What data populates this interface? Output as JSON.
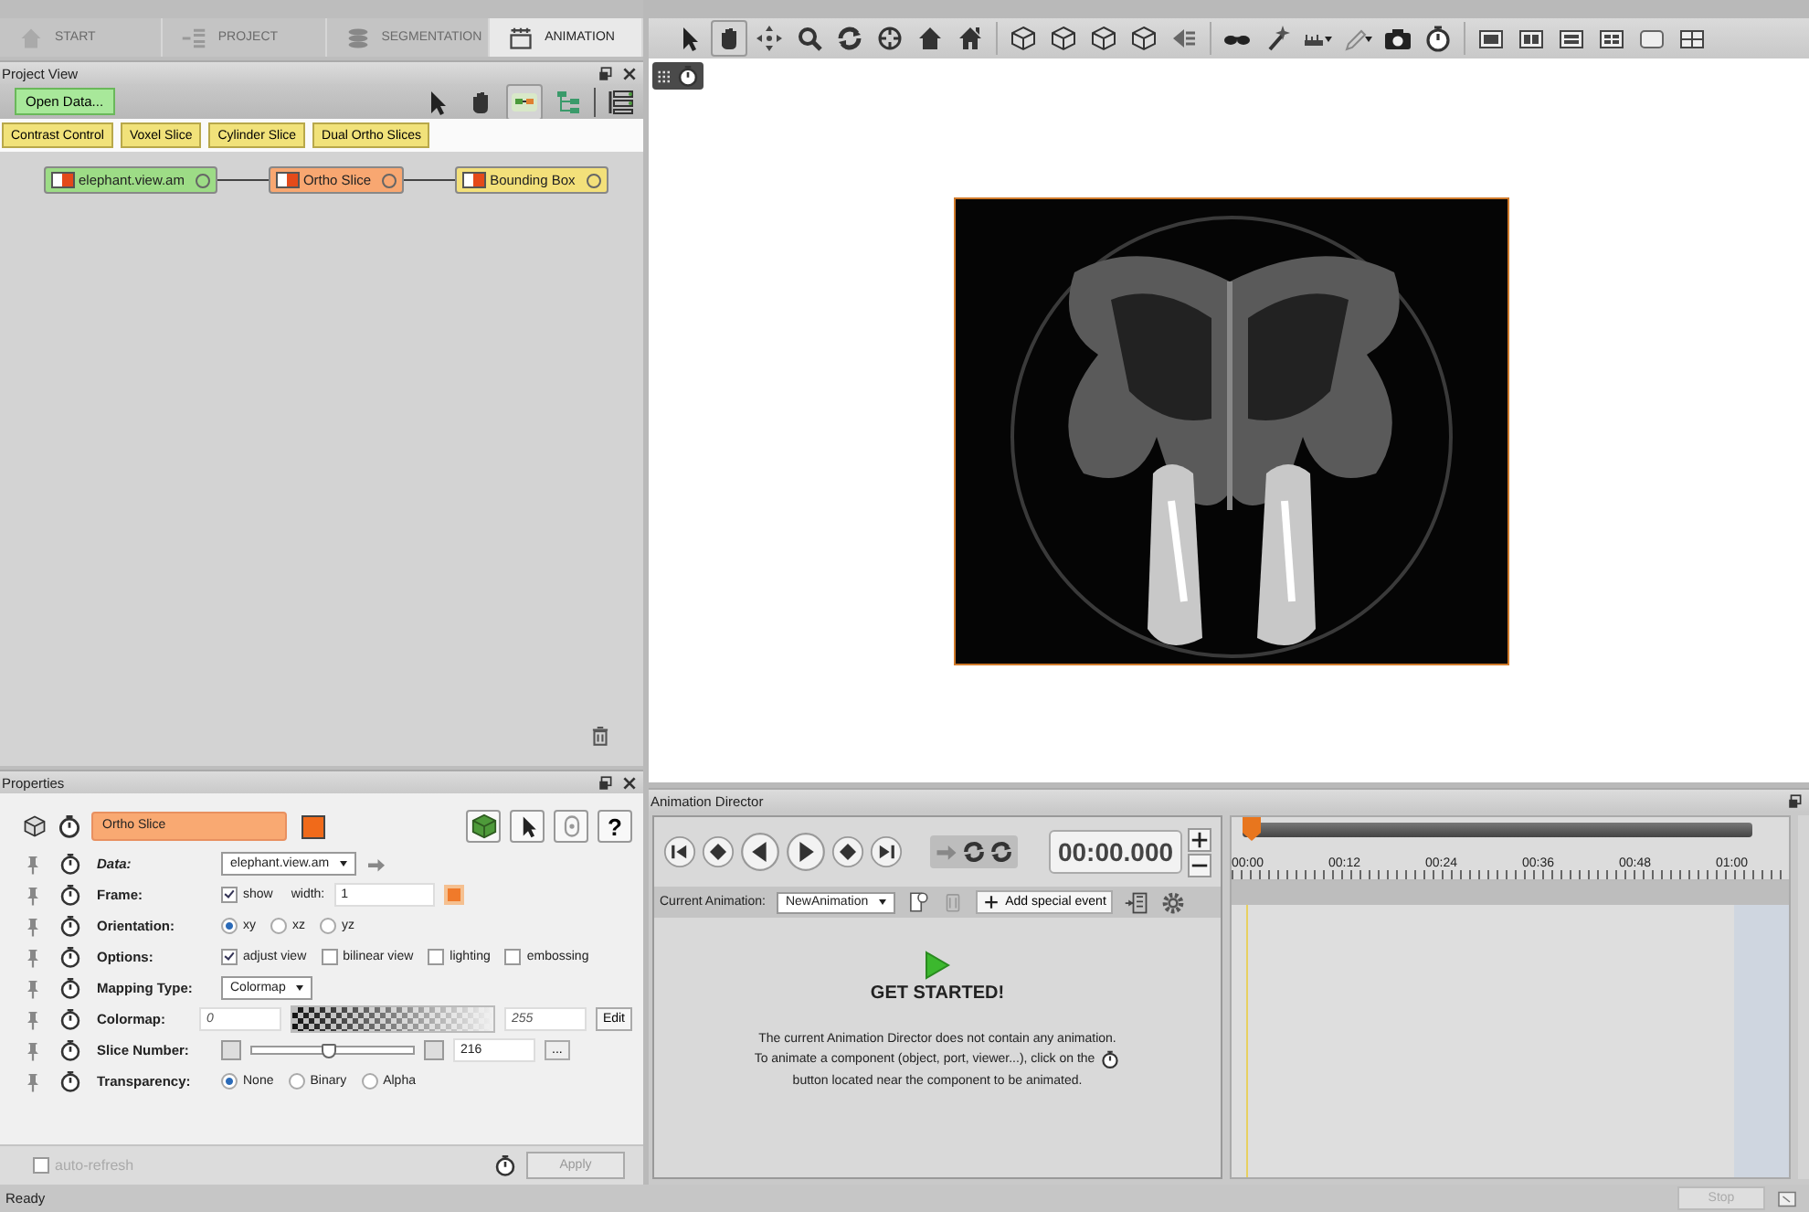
{
  "tabs": [
    {
      "label": "START",
      "selected": false
    },
    {
      "label": "PROJECT",
      "selected": false
    },
    {
      "label": "SEGMENTATION",
      "selected": false
    },
    {
      "label": "ANIMATION",
      "selected": true
    }
  ],
  "project_view": {
    "title": "Project View",
    "open_data_button": "Open Data...",
    "module_buttons": [
      "Contrast Control",
      "Voxel Slice",
      "Cylinder Slice",
      "Dual Ortho Slices"
    ],
    "nodes": [
      {
        "label": "elephant.view.am",
        "color": "#9ddc86"
      },
      {
        "label": "Ortho Slice",
        "color": "#f8a771"
      },
      {
        "label": "Bounding Box",
        "color": "#f3e07a"
      }
    ]
  },
  "properties": {
    "title": "Properties",
    "module_name": "Ortho Slice",
    "help_button": "?",
    "rows": [
      {
        "kind": "dropdown",
        "label": "Data:",
        "italic": true,
        "value": "elephant.view.am"
      },
      {
        "kind": "frame",
        "label": "Frame:",
        "italic": false,
        "check": {
          "label": "show",
          "checked": true
        },
        "field_label": "width:",
        "field_value": "1"
      },
      {
        "kind": "radio",
        "label": "Orientation:",
        "italic": false,
        "options": [
          {
            "label": "xy",
            "selected": true
          },
          {
            "label": "xz",
            "selected": false
          },
          {
            "label": "yz",
            "selected": false
          }
        ]
      },
      {
        "kind": "checks",
        "label": "Options:",
        "italic": false,
        "options": [
          {
            "label": "adjust view",
            "checked": true
          },
          {
            "label": "bilinear view",
            "checked": false
          },
          {
            "label": "lighting",
            "checked": false
          },
          {
            "label": "embossing",
            "checked": false
          }
        ]
      },
      {
        "kind": "dropdown",
        "label": "Mapping Type:",
        "italic": false,
        "value": "Colormap"
      },
      {
        "kind": "colormap",
        "label": "Colormap:",
        "italic": false,
        "min": "0",
        "max": "255",
        "button": "Edit"
      },
      {
        "kind": "slider",
        "label": "Slice Number:",
        "italic": false,
        "level": 0.47,
        "value": "216",
        "button": "..."
      },
      {
        "kind": "radio",
        "label": "Transparency:",
        "italic": false,
        "options": [
          {
            "label": "None",
            "selected": true
          },
          {
            "label": "Binary",
            "selected": false
          },
          {
            "label": "Alpha",
            "selected": false
          }
        ]
      }
    ],
    "auto_refresh": {
      "label": "auto-refresh",
      "checked": false
    },
    "apply_button": "Apply"
  },
  "animation_director": {
    "title": "Animation Director",
    "time": "00:00.000",
    "current_label": "Current Animation:",
    "current_value": "NewAnimation",
    "add_event_button": "Add special event",
    "get_started": "GET STARTED!",
    "message": "The current Animation Director does not contain any animation.",
    "instruction_before": "To animate a component (object, port, viewer...), click on the",
    "instruction_after": "button located near the component to be animated.",
    "ticks": [
      "00:00",
      "00:12",
      "00:24",
      "00:36",
      "00:48",
      "01:00"
    ],
    "playhead": {
      "level": 0
    }
  },
  "status_bar": {
    "text": "Ready",
    "stop_button": "Stop"
  }
}
